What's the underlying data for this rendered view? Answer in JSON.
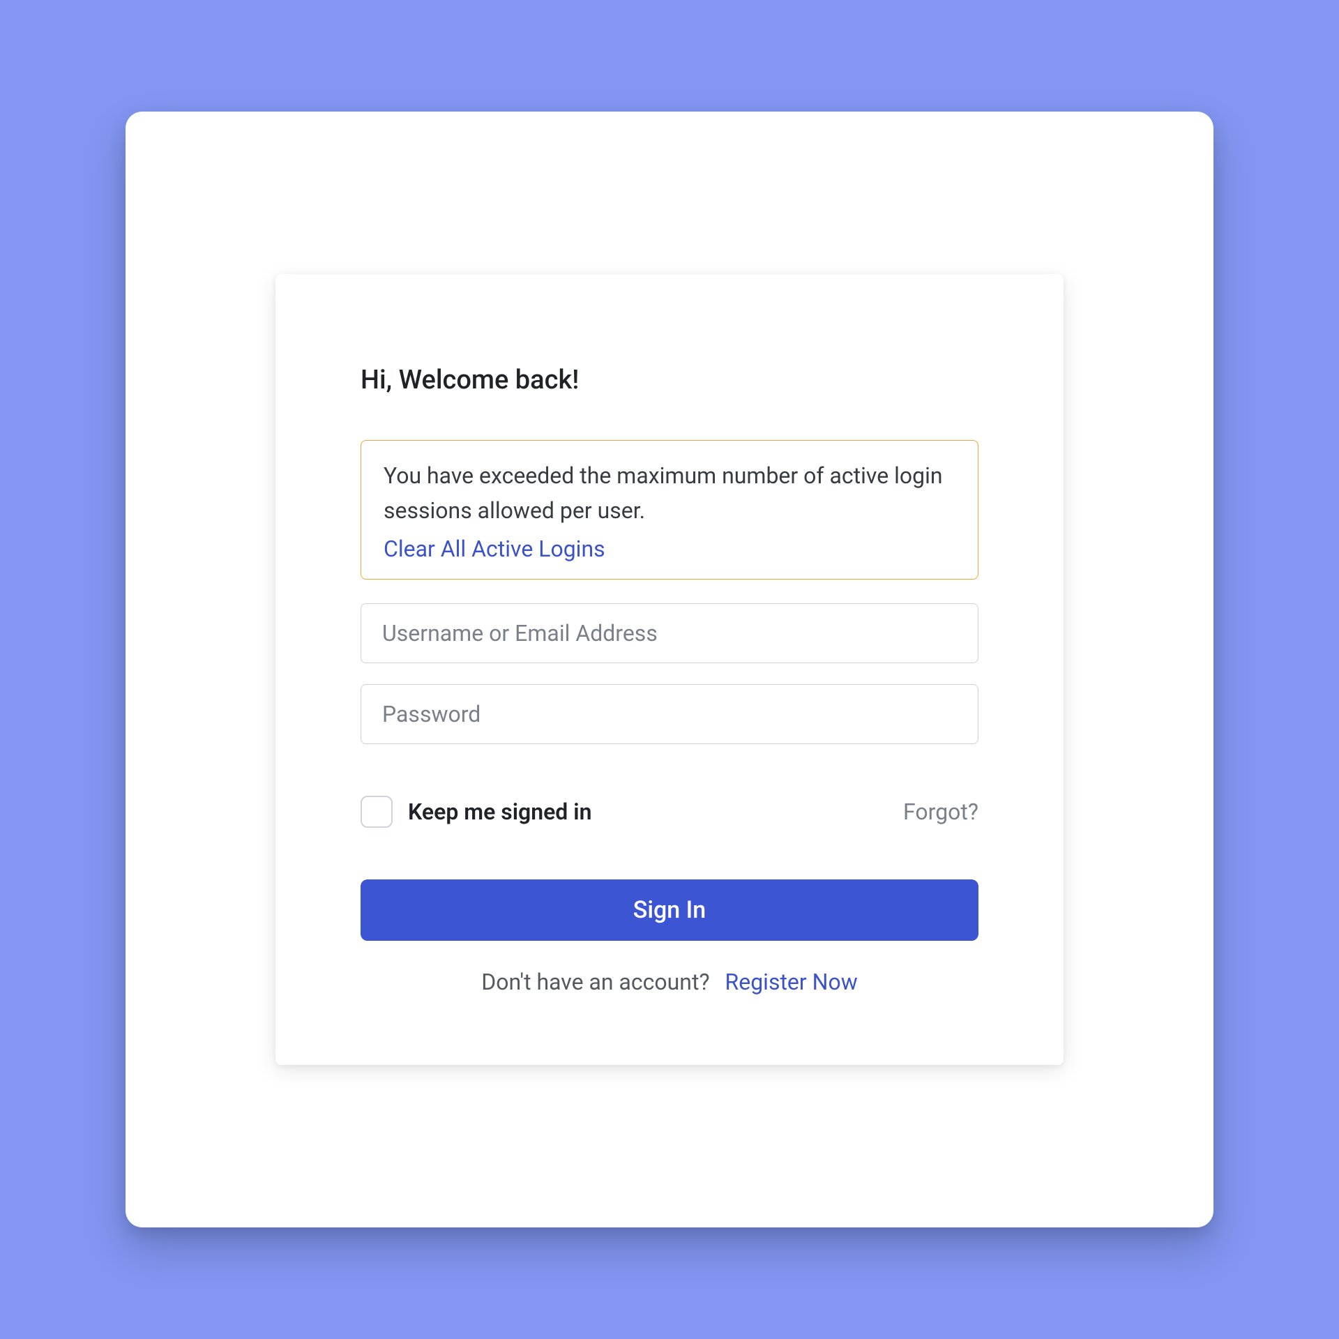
{
  "heading": "Hi, Welcome back!",
  "alert": {
    "message": "You have exceeded the maximum number of active login sessions allowed per user.",
    "action_label": "Clear All Active Logins"
  },
  "fields": {
    "username_placeholder": "Username or Email Address",
    "password_placeholder": "Password"
  },
  "options": {
    "remember_label": "Keep me signed in",
    "forgot_label": "Forgot?"
  },
  "buttons": {
    "signin_label": "Sign In"
  },
  "register": {
    "prompt": "Don't have an account?",
    "link_label": "Register Now"
  }
}
